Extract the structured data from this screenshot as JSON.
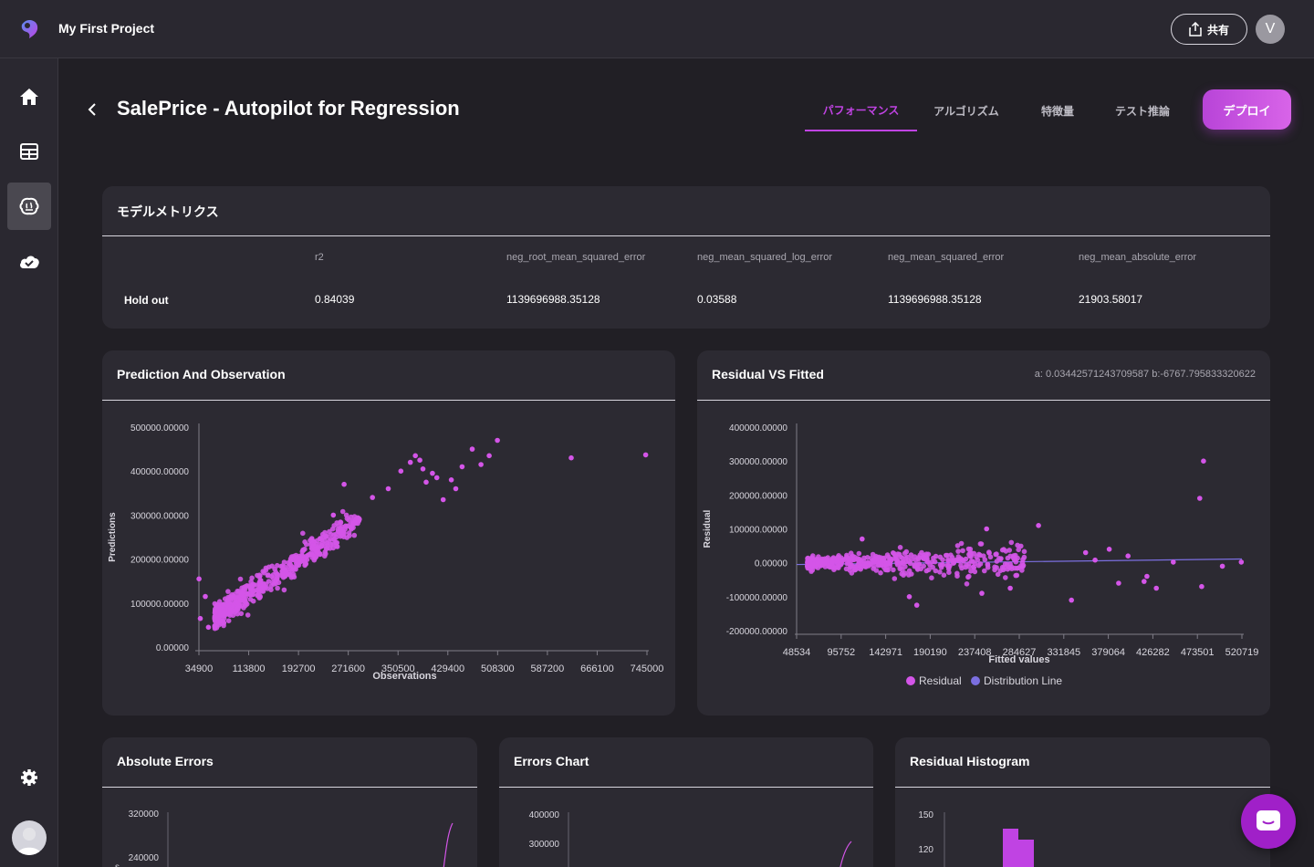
{
  "app": {
    "project_title": "My First Project",
    "share_label": "共有",
    "user_initial": "V"
  },
  "page": {
    "title": "SalePrice - Autopilot for Regression",
    "tabs": [
      {
        "label": "パフォーマンス",
        "active": true
      },
      {
        "label": "アルゴリズム",
        "active": false
      },
      {
        "label": "特徴量",
        "active": false
      },
      {
        "label": "テスト推論",
        "active": false
      }
    ],
    "deploy_label": "デプロイ"
  },
  "sidebar": {
    "items": [
      {
        "icon": "home-icon"
      },
      {
        "icon": "table-icon"
      },
      {
        "icon": "brain-icon",
        "active": true
      },
      {
        "icon": "cloud-check-icon"
      }
    ],
    "settings_icon": "gear-icon"
  },
  "metrics": {
    "title": "モデルメトリクス",
    "columns": [
      "r2",
      "neg_root_mean_squared_error",
      "neg_mean_squared_log_error",
      "neg_mean_squared_error",
      "neg_mean_absolute_error"
    ],
    "rows": [
      {
        "label": "Hold out",
        "values": [
          "0.84039",
          "1139696988.35128",
          "0.03588",
          "1139696988.35128",
          "21903.58017"
        ]
      }
    ]
  },
  "colors": {
    "accent": "#c043e3",
    "point": "#d455e8",
    "line": "#7b6fe0"
  },
  "chart_data": [
    {
      "id": "prediction-observation",
      "type": "scatter",
      "title": "Prediction And Observation",
      "xlabel": "Observations",
      "ylabel": "Predictions",
      "xlim": [
        34900,
        745000
      ],
      "ylim": [
        0,
        500000
      ],
      "x_ticks": [
        "34900",
        "113800",
        "192700",
        "271600",
        "350500",
        "429400",
        "508300",
        "587200",
        "666100",
        "745000"
      ],
      "y_ticks": [
        "0.00000",
        "100000.00000",
        "200000.00000",
        "300000.00000",
        "400000.00000",
        "500000.00000"
      ],
      "outliers": [
        {
          "x": 35000,
          "y": 155000
        },
        {
          "x": 37000,
          "y": 65000
        },
        {
          "x": 45000,
          "y": 115000
        },
        {
          "x": 50000,
          "y": 45000
        },
        {
          "x": 60000,
          "y": 70000
        },
        {
          "x": 248000,
          "y": 300000
        },
        {
          "x": 265000,
          "y": 370000
        },
        {
          "x": 310000,
          "y": 340000
        },
        {
          "x": 335000,
          "y": 360000
        },
        {
          "x": 355000,
          "y": 400000
        },
        {
          "x": 370000,
          "y": 420000
        },
        {
          "x": 378000,
          "y": 435000
        },
        {
          "x": 385000,
          "y": 425000
        },
        {
          "x": 390000,
          "y": 405000
        },
        {
          "x": 395000,
          "y": 375000
        },
        {
          "x": 405000,
          "y": 395000
        },
        {
          "x": 412000,
          "y": 385000
        },
        {
          "x": 422000,
          "y": 335000
        },
        {
          "x": 435000,
          "y": 380000
        },
        {
          "x": 442000,
          "y": 360000
        },
        {
          "x": 452000,
          "y": 410000
        },
        {
          "x": 468000,
          "y": 450000
        },
        {
          "x": 482000,
          "y": 415000
        },
        {
          "x": 495000,
          "y": 435000
        },
        {
          "x": 508000,
          "y": 470000
        },
        {
          "x": 625000,
          "y": 430000
        },
        {
          "x": 743000,
          "y": 437000
        }
      ]
    },
    {
      "id": "residual-fitted",
      "type": "scatter",
      "title": "Residual VS Fitted",
      "coefficients_text": "a: 0.03442571243709587 b:-6767.795833320622",
      "xlabel": "Fitted values",
      "ylabel": "Residual",
      "xlim": [
        48534,
        520719
      ],
      "ylim": [
        -200000,
        400000
      ],
      "x_ticks": [
        "48534",
        "95752",
        "142971",
        "190190",
        "237408",
        "284627",
        "331845",
        "379064",
        "426282",
        "473501",
        "520719"
      ],
      "y_ticks": [
        "-200000.00000",
        "-100000.00000",
        "0.00000",
        "100000.00000",
        "200000.00000",
        "300000.00000",
        "400000.00000"
      ],
      "series": [
        {
          "name": "Residual",
          "color": "#d455e8"
        },
        {
          "name": "Distribution Line",
          "color": "#7b6fe0",
          "line": {
            "a": 0.03442571243709587,
            "b": -6767.795833320622
          }
        }
      ],
      "outliers": [
        {
          "x": 480000,
          "y": 300000
        },
        {
          "x": 476000,
          "y": 190000
        },
        {
          "x": 520000,
          "y": 2000
        },
        {
          "x": 478000,
          "y": -70000
        },
        {
          "x": 448000,
          "y": 2000
        },
        {
          "x": 500000,
          "y": -10000
        },
        {
          "x": 380000,
          "y": 40000
        },
        {
          "x": 390000,
          "y": -60000
        },
        {
          "x": 430000,
          "y": -75000
        },
        {
          "x": 340000,
          "y": -110000
        },
        {
          "x": 420000,
          "y": -40000
        },
        {
          "x": 400000,
          "y": 20000
        },
        {
          "x": 355000,
          "y": 30000
        },
        {
          "x": 365000,
          "y": 8000
        },
        {
          "x": 417000,
          "y": -55000
        },
        {
          "x": 118000,
          "y": 70000
        },
        {
          "x": 168000,
          "y": -100000
        },
        {
          "x": 176000,
          "y": -125000
        },
        {
          "x": 250000,
          "y": 100000
        },
        {
          "x": 305000,
          "y": 110000
        },
        {
          "x": 245000,
          "y": -90000
        },
        {
          "x": 275000,
          "y": -75000
        }
      ]
    },
    {
      "id": "absolute-errors",
      "type": "line",
      "title": "Absolute Errors",
      "y_ticks": [
        "240000",
        "320000"
      ]
    },
    {
      "id": "errors-chart",
      "type": "line",
      "title": "Errors Chart",
      "y_ticks": [
        "300000",
        "400000"
      ]
    },
    {
      "id": "residual-histogram",
      "type": "bar",
      "title": "Residual Histogram",
      "y_ticks": [
        "120",
        "150"
      ]
    }
  ]
}
